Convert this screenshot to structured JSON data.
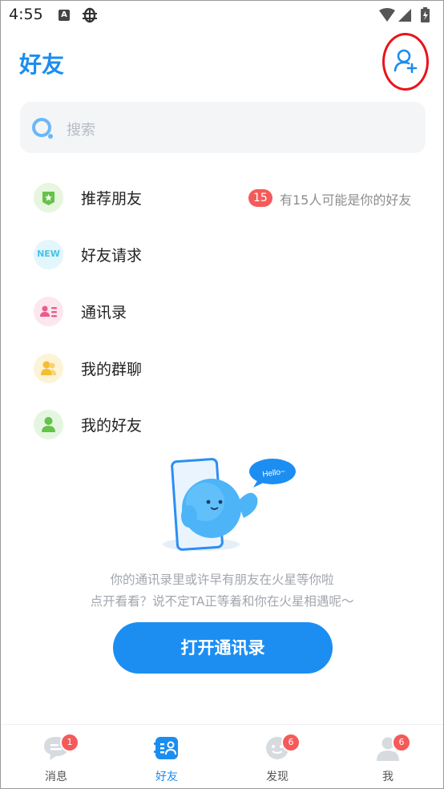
{
  "status_bar": {
    "time": "4:55",
    "icons": [
      "notification-a-icon",
      "bug-icon",
      "wifi-icon",
      "cell-signal-icon",
      "battery-charging-icon"
    ]
  },
  "header": {
    "title": "好友",
    "add_friend_icon": "person-add-icon",
    "highlight_color": "#e8141b"
  },
  "search": {
    "placeholder": "搜索",
    "icon": "search-icon"
  },
  "menu": {
    "items": [
      {
        "label": "推荐朋友",
        "icon": "star-shield-icon",
        "badge": "15",
        "hint": "有15人可能是你的好友"
      },
      {
        "label": "好友请求",
        "icon": "new-tag-icon",
        "icon_text": "NEW"
      },
      {
        "label": "通讯录",
        "icon": "contact-card-icon"
      },
      {
        "label": "我的群聊",
        "icon": "group-chat-icon"
      },
      {
        "label": "我的好友",
        "icon": "person-icon"
      }
    ]
  },
  "empty_state": {
    "bubble_text": "Hello~",
    "line1": "你的通讯录里或许早有朋友在火星等你啦",
    "line2": "点开看看？说不定TA正等着和你在火星相遇呢～",
    "button_label": "打开通讯录"
  },
  "bottom_nav": {
    "tabs": [
      {
        "label": "消息",
        "icon": "chat-bubble-icon",
        "badge": "1"
      },
      {
        "label": "好友",
        "icon": "friends-icon",
        "active": true
      },
      {
        "label": "发现",
        "icon": "discover-icon",
        "badge": "6"
      },
      {
        "label": "我",
        "icon": "profile-icon",
        "badge": "6"
      }
    ]
  },
  "colors": {
    "accent": "#1b8df0",
    "badge": "#f55a5a",
    "text": "#222222",
    "muted": "#a2a6ad"
  }
}
